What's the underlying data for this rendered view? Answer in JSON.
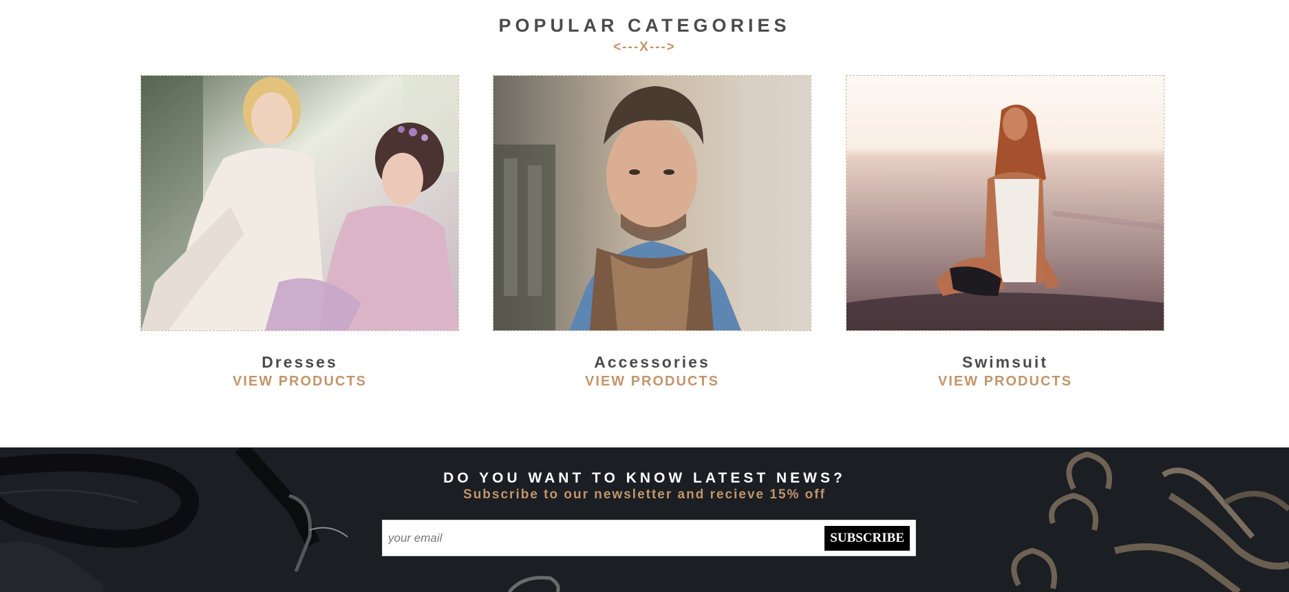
{
  "categories": {
    "title": "POPULAR CATEGORIES",
    "divider": "<---X--->",
    "items": [
      {
        "name": "Dresses",
        "link_label": "VIEW PRODUCTS",
        "image": "two-women-in-dresses-photo"
      },
      {
        "name": "Accessories",
        "link_label": "VIEW PRODUCTS",
        "image": "man-with-scarf-photo"
      },
      {
        "name": "Swimsuit",
        "link_label": "VIEW PRODUCTS",
        "image": "woman-in-swimsuit-at-sea-photo"
      }
    ]
  },
  "newsletter": {
    "title": "DO YOU WANT TO KNOW LATEST NEWS?",
    "subtitle": "Subscribe to our newsletter and recieve 15% off",
    "email_placeholder": "your email",
    "email_value": "",
    "subscribe_label": "SUBSCRIBE"
  },
  "colors": {
    "accent": "#c2956b",
    "heading": "#4b4b4b",
    "newsletter_bg": "#1b1e23"
  }
}
